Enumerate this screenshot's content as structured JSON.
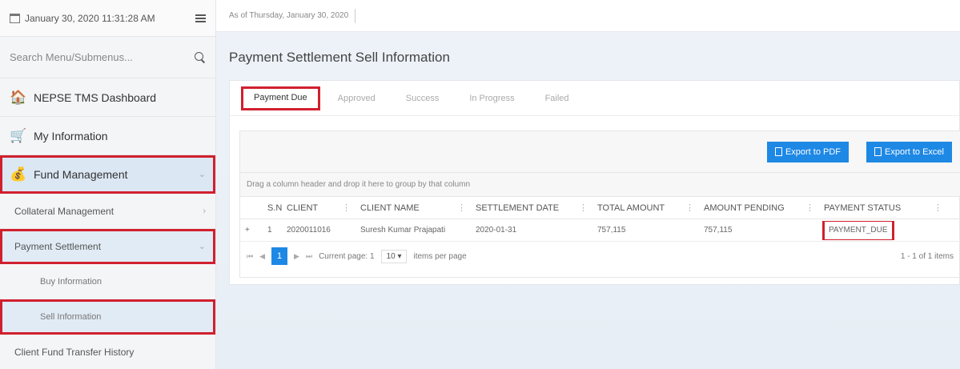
{
  "sidebar": {
    "datetime": "January 30, 2020 11:31:28 AM",
    "search_placeholder": "Search Menu/Submenus...",
    "items": [
      {
        "label": "NEPSE TMS Dashboard",
        "icon": "home-icon"
      },
      {
        "label": "My Information",
        "icon": "cart-icon"
      },
      {
        "label": "Fund Management",
        "icon": "money-bag-icon"
      }
    ],
    "subitems": [
      {
        "label": "Collateral Management"
      },
      {
        "label": "Payment Settlement"
      }
    ],
    "subsubitems": [
      {
        "label": "Buy Information"
      },
      {
        "label": "Sell Information"
      }
    ],
    "extra": {
      "label": "Client Fund Transfer History"
    }
  },
  "topbar": {
    "as_of": "As of Thursday, January 30, 2020"
  },
  "page": {
    "title": "Payment Settlement Sell Information"
  },
  "tabs": [
    "Payment Due",
    "Approved",
    "Success",
    "In Progress",
    "Failed"
  ],
  "toolbar": {
    "export_pdf": "Export to PDF",
    "export_excel": "Export to Excel"
  },
  "grid": {
    "group_hint": "Drag a column header and drop it here to group by that column",
    "columns": [
      "S.N",
      "CLIENT",
      "CLIENT NAME",
      "SETTLEMENT DATE",
      "TOTAL AMOUNT",
      "AMOUNT PENDING",
      "PAYMENT STATUS"
    ],
    "rows": [
      {
        "expand": "+",
        "sn": "1",
        "client": "2020011016",
        "client_name": "Suresh Kumar Prajapati",
        "settlement_date": "2020-01-31",
        "total_amount": "757,115",
        "amount_pending": "757,115",
        "payment_status": "PAYMENT_DUE"
      }
    ]
  },
  "pager": {
    "first": "⏮",
    "prev": "◀",
    "page": "1",
    "next": "▶",
    "last": "⏭",
    "current_page": "Current page: 1",
    "page_size": "10 ▾",
    "items_per_page": "items per page",
    "info": "1 - 1 of 1 items"
  },
  "colors": {
    "accent": "#1e88e5",
    "highlight": "#d0202e",
    "active_bg": "#dbe7f3"
  }
}
